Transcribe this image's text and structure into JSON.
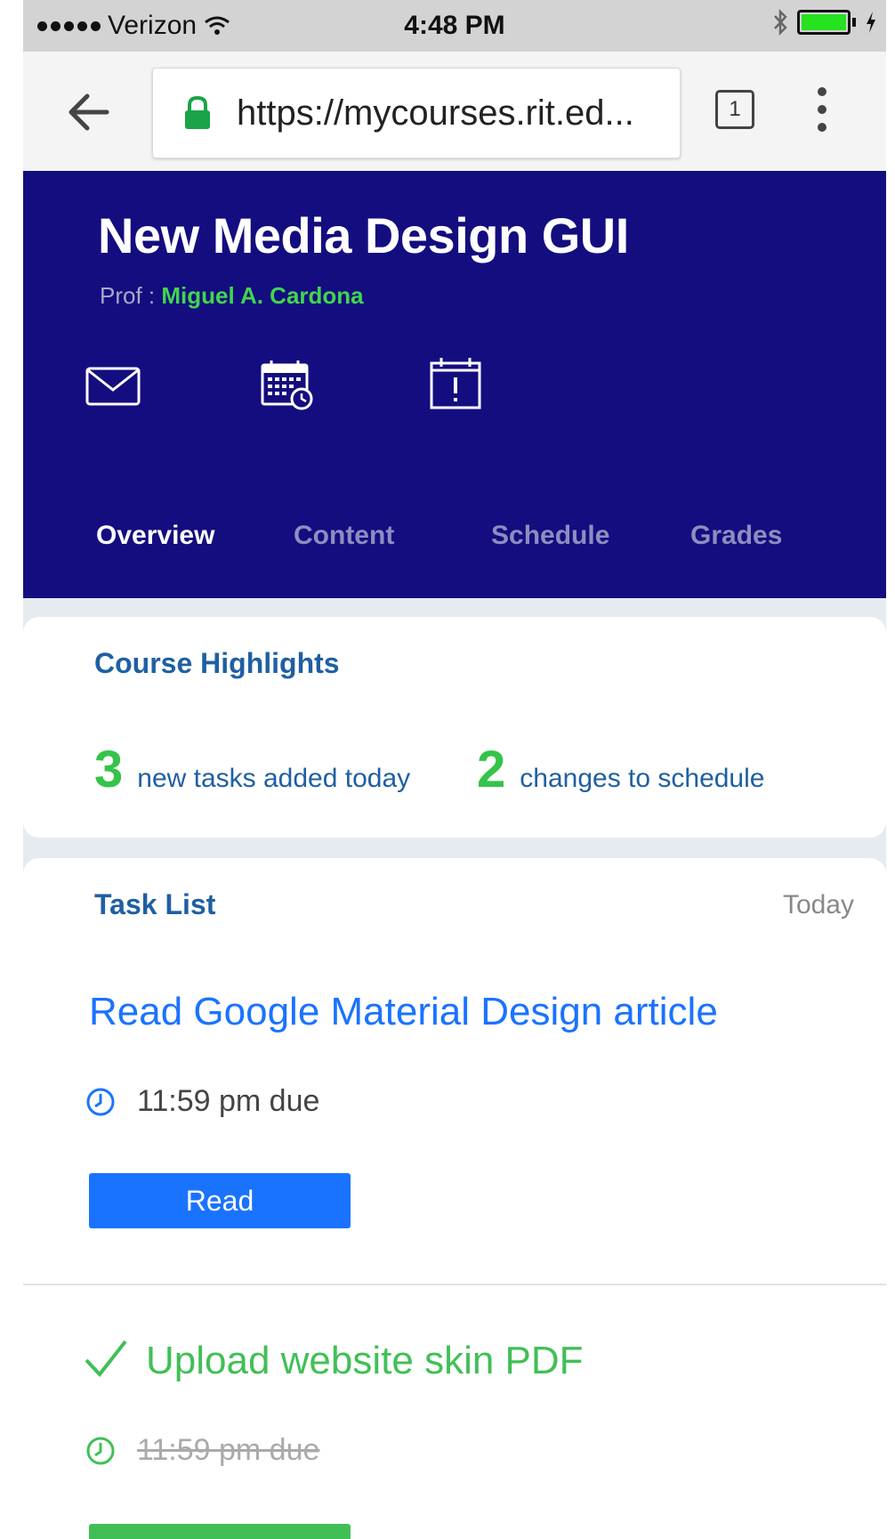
{
  "status_bar": {
    "carrier": "Verizon",
    "time": "4:48 PM",
    "battery_level": 1.0,
    "battery_color": "#26e21f"
  },
  "browser": {
    "url": "https://mycourses.rit.ed...",
    "tab_count": "1",
    "back_icon": "arrow-left-icon",
    "lock_color": "#1aa447"
  },
  "course": {
    "title": "New Media Design GUI",
    "prof_label": "Prof :",
    "prof_name": "Miguel A. Cardona",
    "header_color": "#140d7f",
    "actions": [
      {
        "icon": "mail-icon"
      },
      {
        "icon": "calendar-clock-icon"
      },
      {
        "icon": "calendar-alert-icon"
      }
    ],
    "tabs": [
      {
        "label": "Overview",
        "active": true
      },
      {
        "label": "Content",
        "active": false
      },
      {
        "label": "Schedule",
        "active": false
      },
      {
        "label": "Grades",
        "active": false
      }
    ]
  },
  "highlights": {
    "title": "Course Highlights",
    "stats": [
      {
        "number": "3",
        "text": "new tasks added today"
      },
      {
        "number": "2",
        "text": "changes to schedule"
      }
    ]
  },
  "task_list": {
    "title": "Task List",
    "date_label": "Today",
    "tasks": [
      {
        "title": "Read Google Material Design article",
        "due": "11:59 pm due",
        "button": "Read",
        "done": false,
        "color": "#1a73ff"
      },
      {
        "title": "Upload website skin PDF",
        "due": "11:59 pm due",
        "button": "",
        "done": true,
        "color": "#41bf57"
      }
    ]
  }
}
